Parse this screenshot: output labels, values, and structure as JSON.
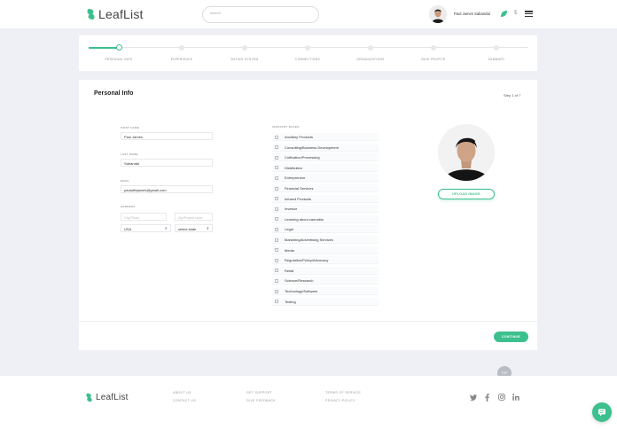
{
  "header": {
    "logo_text": "LeafList",
    "search_placeholder": "search",
    "user_name": "Paul James Sabandal",
    "currency_symbol": "$"
  },
  "stepper": {
    "active_index": 0,
    "steps": [
      {
        "label": "PERSONAL INFO"
      },
      {
        "label": "EXPERIENCE"
      },
      {
        "label": "RATING SYSTEM"
      },
      {
        "label": "CONNECTIONS"
      },
      {
        "label": "ORGANIZATIONS"
      },
      {
        "label": "BUSI PROFITS"
      },
      {
        "label": "SUMMARY"
      }
    ]
  },
  "form": {
    "title": "Personal Info",
    "step_count": "Step 1 of 7",
    "first_name_label": "FIRST NAME",
    "first_name_value": "Paul James",
    "last_name_label": "LAST NAME",
    "last_name_value": "Sabandal",
    "email_label": "EMAIL",
    "email_value": "paulwithjames@gmail.com",
    "address_label": "ADDRESS",
    "city_placeholder": "City/Town",
    "zip_placeholder": "Zip/Postal code",
    "country_value": "USA",
    "state_value": "select state",
    "industry_label": "INDUSTRY ROLES",
    "industries": [
      "Ancillary Products",
      "Consulting/Business Development",
      "Cultivation/Processing",
      "Distribution",
      "Entrepreneur",
      "Financial Services",
      "Infused Products",
      "Investor",
      "Learning about cannabis",
      "Legal",
      "Marketing/Advertising Services",
      "Media",
      "Regulation/Policy/Advocacy",
      "Retail",
      "Science/Research",
      "Technology/Software",
      "Testing"
    ],
    "upload_label": "UPLOAD IMAGE",
    "continue_label": "CONTINUE",
    "top_label": "TOP"
  },
  "footer": {
    "logo_text": "LeafList",
    "links": [
      "ABOUT US",
      "CONTACT US",
      "GET SUPPORT",
      "GIVE FEEDBACK",
      "TERMS OF SERVICE",
      "PRIVACY POLICY"
    ],
    "social_icons": [
      "twitter-icon",
      "facebook-icon",
      "instagram-icon",
      "linkedin-icon"
    ]
  },
  "colors": {
    "accent": "#3cc08d",
    "background": "#eef0f5"
  }
}
